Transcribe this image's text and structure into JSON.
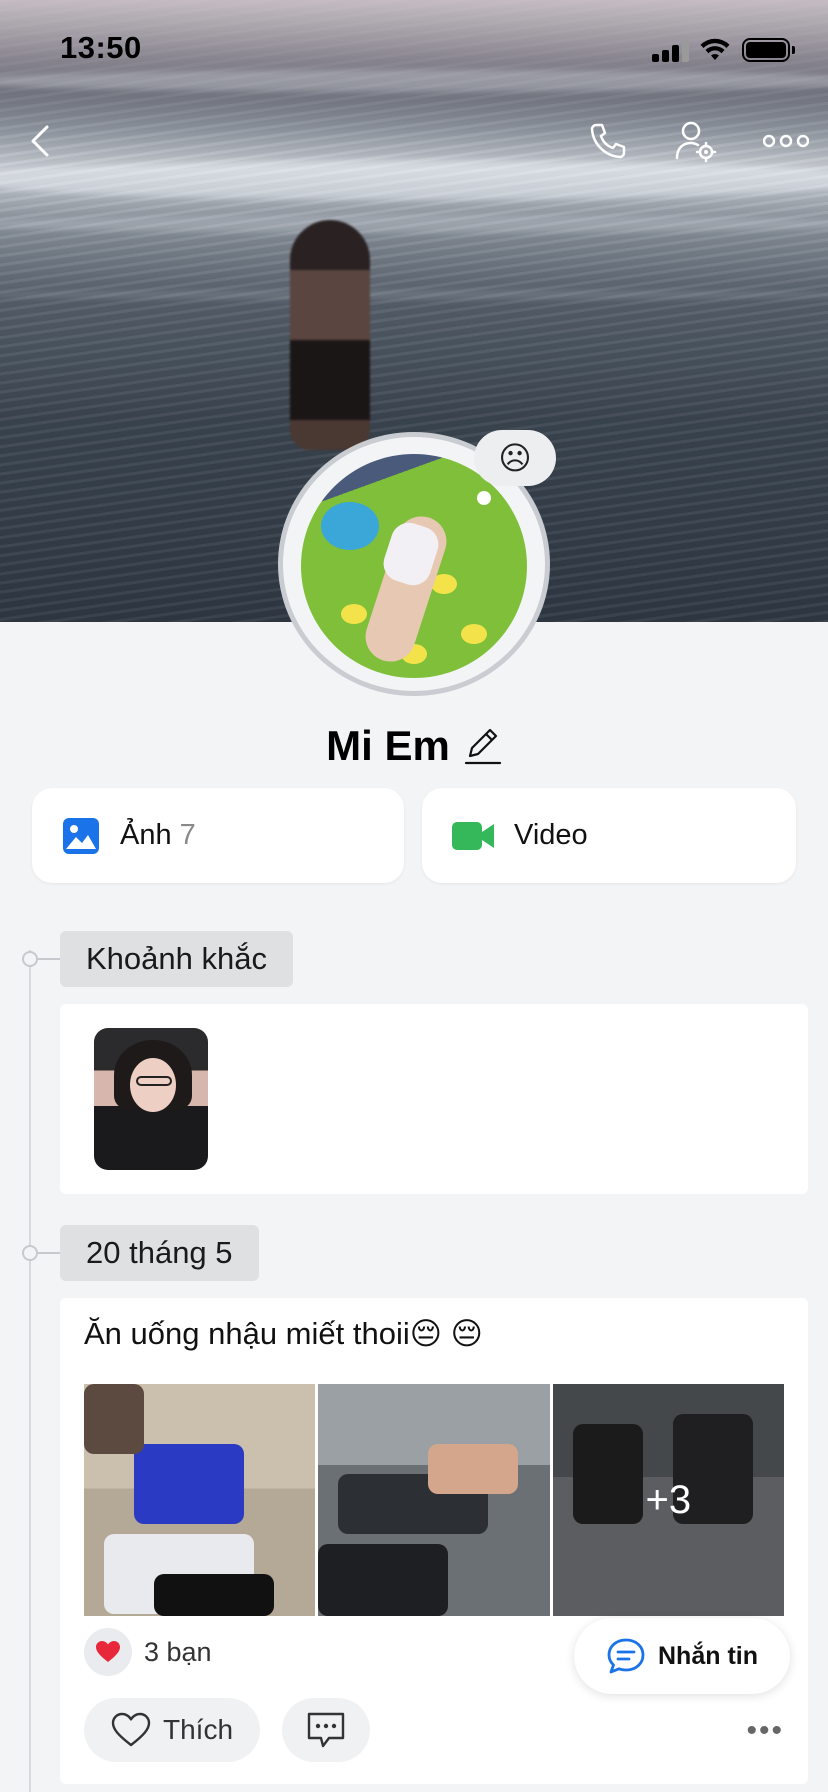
{
  "status_bar": {
    "time": "13:50"
  },
  "profile": {
    "name": "Mi Em",
    "status_emoji": "☹"
  },
  "media": {
    "photos_label": "Ảnh",
    "photos_count": "7",
    "video_label": "Video"
  },
  "timeline": {
    "moments_label": "Khoảnh khắc",
    "post_date": "20 tháng 5"
  },
  "post": {
    "text": "Ăn uống nhậu miết thoii😔 😔",
    "more_photos": "+3",
    "reaction_count": "3 bạn",
    "like_label": "Thích",
    "more_label": "•••"
  },
  "chat_button": {
    "label": "Nhắn tin"
  },
  "colors": {
    "photo_icon": "#1a73e8",
    "video_icon": "#34b85a",
    "chat_icon": "#1a73e8",
    "heart": "#e8283a",
    "background": "#f3f4f6"
  },
  "icons": {
    "back": "chevron-left-icon",
    "call": "phone-icon",
    "settings": "user-settings-icon",
    "more": "more-horizontal-icon",
    "edit": "pencil-icon",
    "photos": "image-icon",
    "video": "video-camera-icon",
    "heart": "heart-icon",
    "like": "heart-outline-icon",
    "comment": "comment-icon",
    "chat": "chat-bubble-icon"
  }
}
